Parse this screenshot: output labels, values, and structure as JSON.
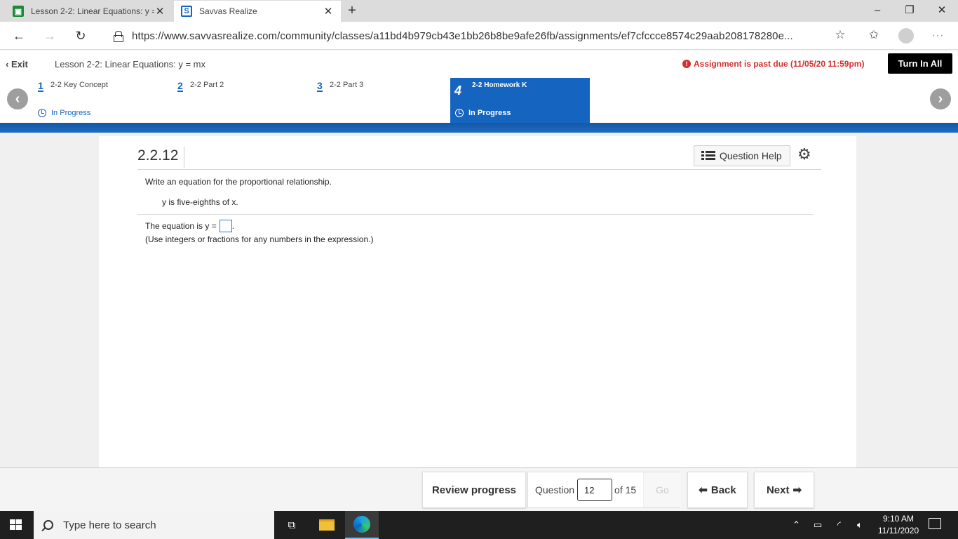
{
  "browser": {
    "tabs": [
      {
        "label": "Lesson 2-2: Linear Equations: y = mx",
        "active": false
      },
      {
        "label": "Savvas Realize",
        "active": true
      }
    ],
    "tab_close": "✕",
    "new_tab": "+",
    "window_controls": {
      "minimize": "–",
      "restore": "❐",
      "close": "✕"
    },
    "url": "https://www.savvasrealize.com/community/classes/a11bd4b979cb43e1bb26b8be9afe26fb/assignments/ef7cfccce8574c29aab208178280e..."
  },
  "header": {
    "exit_label": "Exit",
    "lesson_title": "Lesson 2-2: Linear Equations: y = mx",
    "past_due": "Assignment is past due (11/05/20 11:59pm)",
    "turn_in_label": "Turn In All"
  },
  "steps": [
    {
      "number": "1",
      "label": "2-2 Key Concept",
      "status": "In Progress"
    },
    {
      "number": "2",
      "label": "2-2 Part 2",
      "status": ""
    },
    {
      "number": "3",
      "label": "2-2 Part 3",
      "status": ""
    },
    {
      "number": "4",
      "label": "2-2 Homework K",
      "status": "In Progress",
      "active": true
    }
  ],
  "question": {
    "number": "2.2.12",
    "help_label": "Question Help",
    "prompt": "Write an equation for the proportional relationship.",
    "relation": "y is five-eighths of x.",
    "answer_prefix": "The equation is y =",
    "answer_suffix": ".",
    "hint": "(Use integers or fractions for any numbers in the expression.)"
  },
  "footer": {
    "review_label": "Review progress",
    "question_label": "Question",
    "question_value": "12",
    "of_label": "of 15",
    "go_label": "Go",
    "back_label": "Back",
    "next_label": "Next"
  },
  "taskbar": {
    "search_placeholder": "Type here to search",
    "time": "9:10 AM",
    "date": "11/11/2020"
  },
  "colors": {
    "accent": "#1565c0",
    "past_due": "#d32f2f"
  }
}
